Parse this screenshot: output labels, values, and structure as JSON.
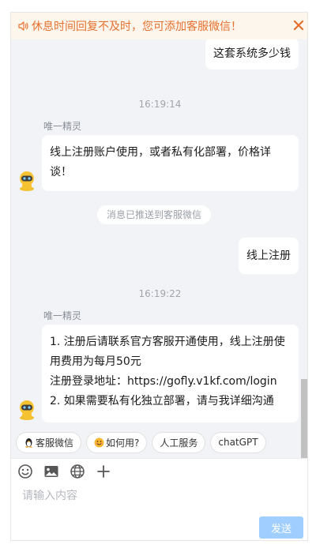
{
  "notice": {
    "text": "休息时间回复不及时，您可添加客服微信！",
    "color": "#e6702e"
  },
  "messages": {
    "m1_text": "这套系统多少钱",
    "time1": "16:19:14",
    "m2_name": "唯一精灵",
    "m2_line1": "线上注册账户使用，或者私有化部署，价格详",
    "m2_line2": "谈！",
    "system_pill": "消息已推送到客服微信",
    "m3_text": "线上注册",
    "time2": "16:19:22",
    "m4_name": "唯一精灵",
    "m4_line1": "1. 注册后请联系官方客服开通使用，线上注册使",
    "m4_line2": "用费用为每月50元",
    "m4_line3": "注册登录地址：https://gofly.v1kf.com/login",
    "m4_line4": "2. 如果需要私有化独立部署，请与我详细沟通"
  },
  "quick_replies": {
    "wechat": "客服微信",
    "howto": "如何用?",
    "human": "人工服务",
    "chatgpt": "chatGPT"
  },
  "input": {
    "placeholder": "请输入内容",
    "send_label": "发送"
  },
  "icons": {
    "speaker": "speaker-icon",
    "close": "close-icon",
    "robot_avatar": "robot-avatar",
    "emoji": "emoji-icon",
    "image": "image-icon",
    "globe": "globe-icon",
    "plus": "plus-icon"
  },
  "colors": {
    "accent": "#409eff",
    "send_disabled": "#a0cfff",
    "notice_bg": "#fdf6ec"
  }
}
